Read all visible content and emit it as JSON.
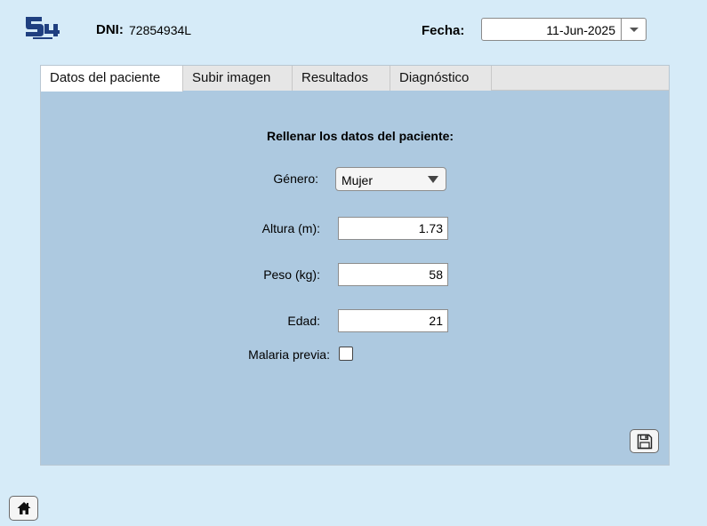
{
  "header": {
    "logo_icon": "s4-logo-icon",
    "dni_label": "DNI:",
    "dni_value": "72854934L",
    "fecha_label": "Fecha:",
    "fecha_value": "11-Jun-2025"
  },
  "tabs": [
    {
      "label": "Datos del paciente",
      "active": true
    },
    {
      "label": "Subir imagen",
      "active": false
    },
    {
      "label": "Resultados",
      "active": false
    },
    {
      "label": "Diagnóstico",
      "active": false
    }
  ],
  "form": {
    "title": "Rellenar los datos del paciente:",
    "genero_label": "Género:",
    "genero_value": "Mujer",
    "altura_label": "Altura (m):",
    "altura_value": "1.73",
    "peso_label": "Peso (kg):",
    "peso_value": "58",
    "edad_label": "Edad:",
    "edad_value": "21",
    "malaria_label": "Malaria previa:",
    "malaria_checked": false
  },
  "icons": {
    "save": "floppy-disk-icon",
    "home": "home-icon",
    "date_dropdown": "chevron-down-icon"
  },
  "colors": {
    "background": "#d6ebf8",
    "panel": "#adc9e0",
    "logo": "#1f3f80"
  }
}
